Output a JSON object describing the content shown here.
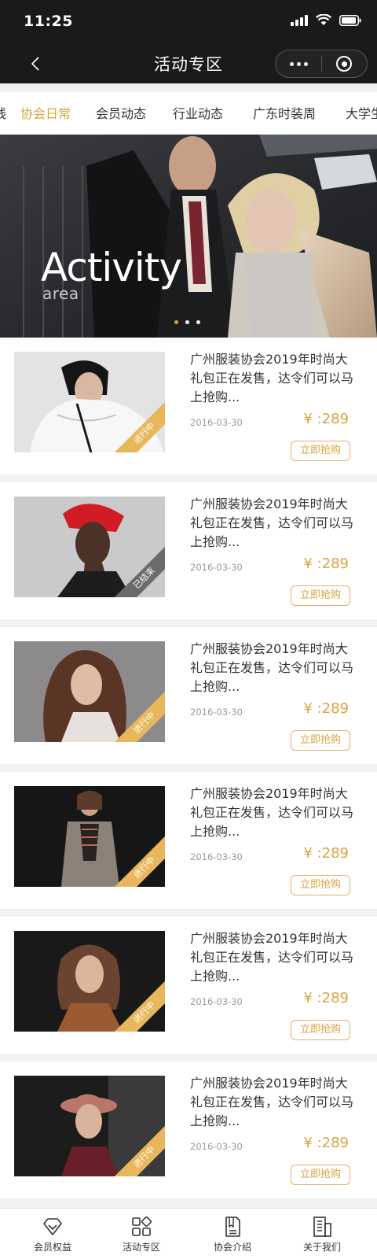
{
  "status": {
    "time": "11:25"
  },
  "nav": {
    "title": "活动专区"
  },
  "tabs": [
    {
      "label": "线"
    },
    {
      "label": "协会日常",
      "active": true
    },
    {
      "label": "会员动态"
    },
    {
      "label": "行业动态"
    },
    {
      "label": "广东时装周"
    },
    {
      "label": "大学生"
    }
  ],
  "banner": {
    "title": "Activity",
    "subtitle": "area"
  },
  "cards": [
    {
      "title": "广州服装协会2019年时尚大礼包正在发售，达令们可以马上抢购...",
      "date": "2016-03-30",
      "price": "¥ :289",
      "button": "立即抢购",
      "ribbon": "进行中",
      "ribbon_state": "on"
    },
    {
      "title": "广州服装协会2019年时尚大礼包正在发售，达令们可以马上抢购...",
      "date": "2016-03-30",
      "price": "¥ :289",
      "button": "立即抢购",
      "ribbon": "已结束",
      "ribbon_state": "off"
    },
    {
      "title": "广州服装协会2019年时尚大礼包正在发售，达令们可以马上抢购...",
      "date": "2016-03-30",
      "price": "¥ :289",
      "button": "立即抢购",
      "ribbon": "进行中",
      "ribbon_state": "on"
    },
    {
      "title": "广州服装协会2019年时尚大礼包正在发售，达令们可以马上抢购...",
      "date": "2016-03-30",
      "price": "¥ :289",
      "button": "立即抢购",
      "ribbon": "进行中",
      "ribbon_state": "on"
    },
    {
      "title": "广州服装协会2019年时尚大礼包正在发售，达令们可以马上抢购...",
      "date": "2016-03-30",
      "price": "¥ :289",
      "button": "立即抢购",
      "ribbon": "进行中",
      "ribbon_state": "on"
    },
    {
      "title": "广州服装协会2019年时尚大礼包正在发售，达令们可以马上抢购...",
      "date": "2016-03-30",
      "price": "¥ :289",
      "button": "立即抢购",
      "ribbon": "进行中",
      "ribbon_state": "on"
    }
  ],
  "tabbar": [
    {
      "label": "会员权益",
      "icon": "diamond-icon"
    },
    {
      "label": "活动专区",
      "icon": "grid-icon"
    },
    {
      "label": "协会介绍",
      "icon": "document-icon"
    },
    {
      "label": "关于我们",
      "icon": "building-icon"
    }
  ],
  "colors": {
    "accent": "#d9a441",
    "dark": "#1a1a1a",
    "ribbon_on": "#e8b75c",
    "ribbon_off": "#6b6b6b"
  }
}
